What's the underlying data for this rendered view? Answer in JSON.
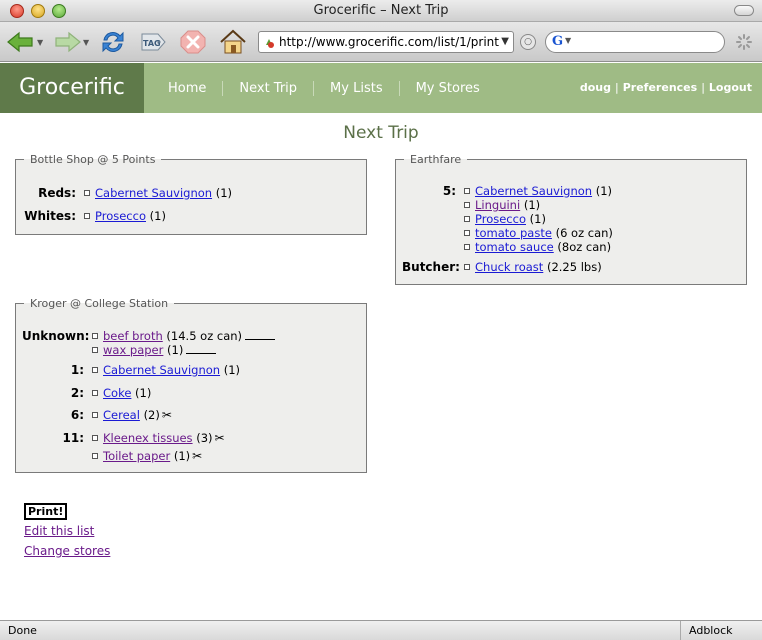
{
  "window": {
    "title": "Grocerific – Next Trip"
  },
  "browser": {
    "url": "http://www.grocerific.com/list/1/print",
    "search_engine_letter": "G",
    "search_value": "",
    "tag_label": "TAG",
    "status": "Done",
    "adblock_label": "Adblock"
  },
  "site": {
    "logo": "Grocerific",
    "nav": [
      "Home",
      "Next Trip",
      "My Lists",
      "My Stores"
    ],
    "user": {
      "name": "doug",
      "preferences": "Preferences",
      "logout": "Logout"
    },
    "page_title": "Next Trip"
  },
  "stores": {
    "bottle_shop": {
      "name": "Bottle Shop @ 5 Points",
      "aisles": [
        {
          "name": "Reds:",
          "items": [
            {
              "name": "Cabernet Sauvignon",
              "qty": "(1)"
            }
          ]
        },
        {
          "name": "Whites:",
          "items": [
            {
              "name": "Prosecco",
              "qty": "(1)"
            }
          ]
        }
      ]
    },
    "earthfare": {
      "name": "Earthfare",
      "aisles": [
        {
          "name": "5:",
          "items": [
            {
              "name": "Cabernet Sauvignon",
              "qty": "(1)"
            },
            {
              "name": "Linguini",
              "qty": "(1)"
            },
            {
              "name": "Prosecco",
              "qty": "(1)"
            },
            {
              "name": "tomato paste",
              "qty": "(6 oz can)"
            },
            {
              "name": "tomato sauce",
              "qty": "(8oz can)"
            }
          ]
        },
        {
          "name": "Butcher:",
          "items": [
            {
              "name": "Chuck roast",
              "qty": "(2.25 lbs)"
            }
          ]
        }
      ]
    },
    "kroger": {
      "name": "Kroger @ College Station",
      "aisles": [
        {
          "name": "Unknown:",
          "items": [
            {
              "name": "beef broth",
              "qty": "(14.5 oz can)"
            },
            {
              "name": "wax paper",
              "qty": "(1)"
            }
          ]
        },
        {
          "name": "1:",
          "items": [
            {
              "name": "Cabernet Sauvignon",
              "qty": "(1)"
            }
          ]
        },
        {
          "name": "2:",
          "items": [
            {
              "name": "Coke",
              "qty": "(1)"
            }
          ]
        },
        {
          "name": "6:",
          "items": [
            {
              "name": "Cereal",
              "qty": "(2)"
            }
          ]
        },
        {
          "name": "11:",
          "items": [
            {
              "name": "Kleenex tissues",
              "qty": "(3)"
            },
            {
              "name": "Toilet paper",
              "qty": "(1)"
            }
          ]
        }
      ]
    }
  },
  "actions": {
    "print": "Print!",
    "edit": "Edit this list",
    "change": "Change stores"
  },
  "colors": {
    "header": "#9fbb85",
    "logo_bg": "#5f7a4a",
    "title": "#5b7048",
    "store_bg": "#eeeeec"
  }
}
